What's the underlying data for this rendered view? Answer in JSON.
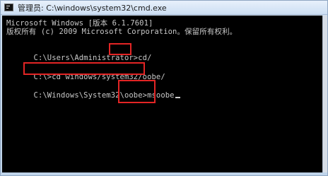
{
  "window": {
    "title": "管理员: C:\\windows\\system32\\cmd.exe"
  },
  "console": {
    "line1": "Microsoft Windows [版本 6.1.7601]",
    "line2": "版权所有 (c) 2009 Microsoft Corporation。保留所有权利。",
    "line3_prompt": "C:\\Users\\Administrator>",
    "line3_cmd": "cd/",
    "line4_prompt": "C:\\>",
    "line4_cmd": "cd windows/system32/oobe/",
    "line5_prompt": "C:\\Windows\\System32\\oobe>",
    "line5_cmd": "msoobe"
  },
  "colors": {
    "highlight": "#e32525"
  }
}
